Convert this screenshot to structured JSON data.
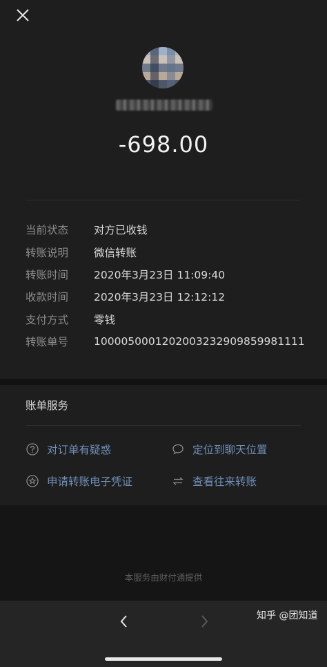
{
  "header": {
    "close_icon": "close-icon"
  },
  "transfer": {
    "amount": "-698.00"
  },
  "details": [
    {
      "label": "当前状态",
      "value": "对方已收钱"
    },
    {
      "label": "转账说明",
      "value": "微信转账"
    },
    {
      "label": "转账时间",
      "value": "2020年3月23日 11:09:40"
    },
    {
      "label": "收款时间",
      "value": "2020年3月23日 12:12:12"
    },
    {
      "label": "支付方式",
      "value": "零钱"
    },
    {
      "label": "转账单号",
      "value": "1000050001202003232909859981111"
    }
  ],
  "services": {
    "title": "账单服务",
    "items": [
      {
        "label": "对订单有疑惑",
        "icon": "question-circle-icon"
      },
      {
        "label": "定位到聊天位置",
        "icon": "chat-bubble-icon"
      },
      {
        "label": "申请转账电子凭证",
        "icon": "badge-star-icon"
      },
      {
        "label": "查看往来转账",
        "icon": "transfer-arrows-icon"
      }
    ]
  },
  "footer": {
    "note": "本服务由财付通提供"
  },
  "nav": {
    "back_icon": "chevron-left-icon",
    "forward_icon": "chevron-right-icon"
  },
  "watermark": "知乎 @团知道",
  "colors": {
    "background": "#1e1e1e",
    "link": "#6f8fb8",
    "label": "#8c8c8c",
    "amount": "#f2f2f2"
  }
}
